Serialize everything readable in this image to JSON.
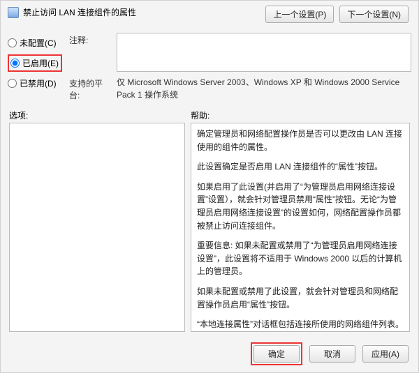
{
  "title": "禁止访问 LAN 连接组件的属性",
  "nav": {
    "prev_label": "上一个设置(P)",
    "next_label": "下一个设置(N)"
  },
  "radios": {
    "not_configured": "未配置(C)",
    "enabled": "已启用(E)",
    "disabled": "已禁用(D)",
    "selected": "enabled"
  },
  "labels": {
    "comment": "注释:",
    "platform": "支持的平台:",
    "options": "选项:",
    "help": "帮助:"
  },
  "comment_value": "",
  "platform_text": "仅 Microsoft Windows Server 2003、Windows XP 和 Windows 2000 Service Pack 1 操作系统",
  "help": {
    "p1": "确定管理员和网络配置操作员是否可以更改由 LAN 连接使用的组件的属性。",
    "p2": "此设置确定是否启用 LAN 连接组件的“属性”按钮。",
    "p3": "如果启用了此设置(并启用了“为管理员启用网络连接设置”设置），就会针对管理员禁用“属性”按钮。无论“为管理员启用网络连接设置”的设置如何，网络配置操作员都被禁止访问连接组件。",
    "p4": "重要信息: 如果未配置或禁用了“为管理员启用网络连接设置”，此设置将不适用于 Windows 2000 以后的计算机上的管理员。",
    "p5": "如果未配置或禁用了此设置，就会针对管理员和网络配置操作员启用“属性”按钮。",
    "p6": "“本地连接属性”对话框包括连接所使用的网络组件列表。要查看或更改组件的属性，请单击组件名称，然后单击组件列表下面的“属性”按钮。"
  },
  "buttons": {
    "ok": "确定",
    "cancel": "取消",
    "apply": "应用(A)"
  }
}
